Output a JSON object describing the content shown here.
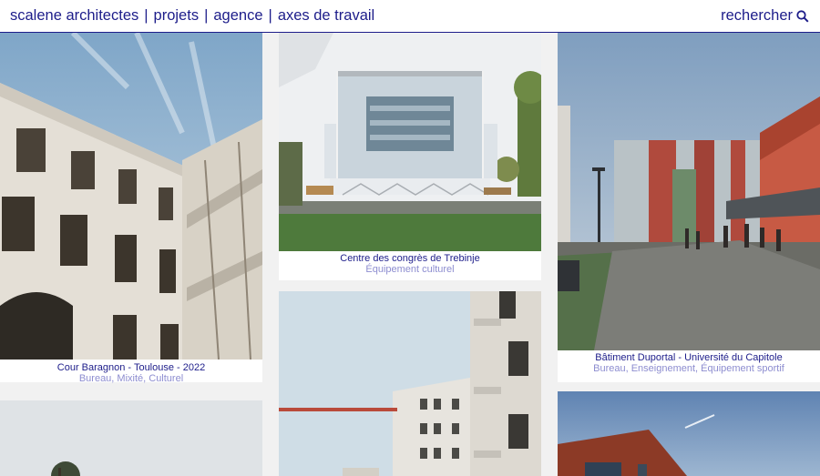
{
  "header": {
    "brand": "scalene architectes",
    "separator": "|",
    "nav": [
      "projets",
      "agence",
      "axes de travail"
    ],
    "search_label": "rechercher",
    "search_icon": "search-icon"
  },
  "projects": [
    {
      "title": "Cour Baragnon - Toulouse - 2022",
      "subtitle": "Bureau, Mixité, Culturel"
    },
    {
      "title": "Centre des congrès de Trebinje",
      "subtitle": "Équipement culturel"
    },
    {
      "title": "Bâtiment Duportal - Université du Capitole",
      "subtitle": "Bureau, Enseignement, Équipement sportif"
    }
  ],
  "colors": {
    "accent": "#1d1d8a",
    "secondary": "#8d8dd0",
    "background": "#f1f1f1"
  }
}
